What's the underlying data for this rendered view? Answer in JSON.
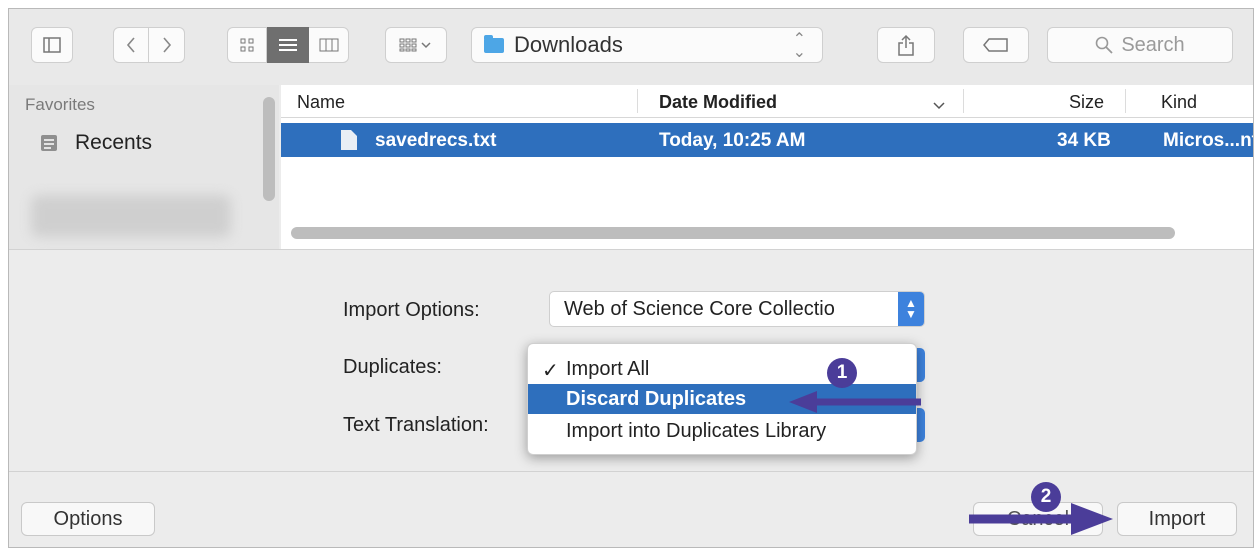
{
  "toolbar": {
    "location": "Downloads",
    "search_placeholder": "Search",
    "icons": [
      "sidebar-icon",
      "back-icon",
      "forward-icon",
      "icon-view-icon",
      "list-view-icon",
      "column-view-icon",
      "group-icon",
      "share-icon",
      "tag-icon",
      "search-icon"
    ]
  },
  "sidebar": {
    "section_title": "Favorites",
    "items": [
      {
        "label": "Recents",
        "icon": "recents-icon"
      }
    ]
  },
  "file_list": {
    "columns": [
      "Name",
      "Date Modified",
      "Size",
      "Kind"
    ],
    "sort_column": "Date Modified",
    "rows": [
      {
        "name": "savedrecs.txt",
        "date_modified": "Today, 10:25 AM",
        "size": "34 KB",
        "kind": "Micros...nt",
        "selected": true
      }
    ]
  },
  "options": {
    "import_options_label": "Import Options:",
    "import_options_value": "Web of Science Core Collectio",
    "duplicates_label": "Duplicates:",
    "text_translation_label": "Text Translation:",
    "duplicates_menu": [
      {
        "label": "Import All",
        "checked": true
      },
      {
        "label": "Discard Duplicates",
        "highlighted": true
      },
      {
        "label": "Import into Duplicates Library"
      }
    ]
  },
  "annotations": {
    "step1": "1",
    "step2": "2",
    "arrow_color": "#4b3d99"
  },
  "buttons": {
    "options": "Options",
    "cancel": "Cancel",
    "import": "Import"
  },
  "colors": {
    "selection": "#2e6fbd",
    "accent": "#3d82dd"
  }
}
